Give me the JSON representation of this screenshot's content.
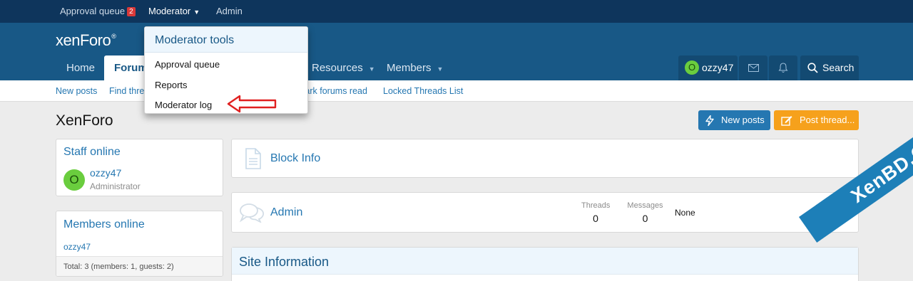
{
  "staff_bar": {
    "approval_queue": "Approval queue",
    "approval_count": "2",
    "moderator": "Moderator",
    "admin": "Admin"
  },
  "header": {
    "logo_text": "xenForo",
    "logo_suffix": "®"
  },
  "nav": {
    "home": "Home",
    "forums": "Forums",
    "resources": "Resources",
    "members": "Members",
    "user_initial": "O",
    "username": "ozzy47",
    "search": "Search"
  },
  "subnav": {
    "new_posts": "New posts",
    "find_threads": "Find threads",
    "mark_forums_read": "Mark forums read",
    "locked_threads": "Locked Threads List"
  },
  "page": {
    "title": "XenForo",
    "new_posts_btn": "New posts",
    "post_thread_btn": "Post thread..."
  },
  "sidebar": {
    "staff_online": {
      "title": "Staff online",
      "user_initial": "O",
      "username": "ozzy47",
      "role": "Administrator"
    },
    "members_online": {
      "title": "Members online",
      "user": "ozzy47",
      "total": "Total: 3 (members: 1, guests: 2)"
    }
  },
  "main": {
    "block_info": "Block Info",
    "admin_forum": {
      "title": "Admin",
      "threads_label": "Threads",
      "threads": "0",
      "messages_label": "Messages",
      "messages": "0",
      "last_post": "None"
    },
    "site_info": "Site Information"
  },
  "dropdown": {
    "title": "Moderator tools",
    "items": [
      "Approval queue",
      "Reports",
      "Moderator log"
    ]
  },
  "watermark": "XenBD.Com",
  "colors": {
    "staff_bar": "#0e355c",
    "header": "#185886",
    "link": "#2577b1",
    "new_posts_btn": "#2577b1",
    "post_thread_btn": "#f6a11c",
    "arrow": "#e02020",
    "avatar": "#6acd3e"
  }
}
